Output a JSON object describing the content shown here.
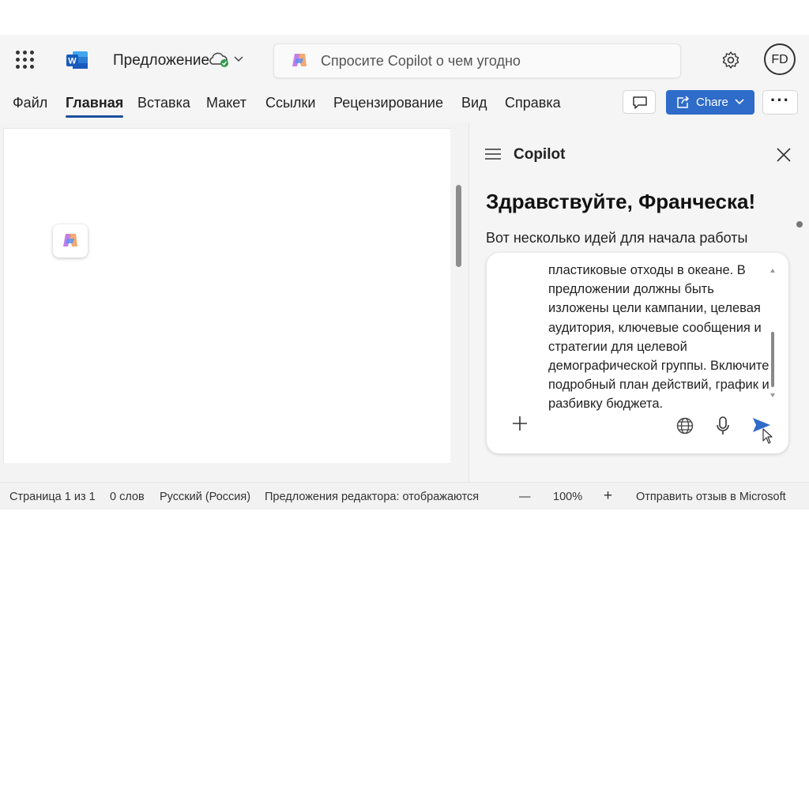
{
  "app": {
    "document_title": "Предложение",
    "search_placeholder": "Спросите Copilot о чем угодно",
    "avatar_initials": "FD",
    "accent_color": "#2f6bc9"
  },
  "ribbon": {
    "tabs": [
      {
        "label": "Файл"
      },
      {
        "label": "Главная",
        "active": true
      },
      {
        "label": "Вставка"
      },
      {
        "label": "Макет"
      },
      {
        "label": "Ссылки"
      },
      {
        "label": "Рецензирование"
      },
      {
        "label": "Вид"
      },
      {
        "label": "Справка"
      }
    ],
    "share_label": "Chare",
    "more_label": "···"
  },
  "copilot": {
    "title": "Copilot",
    "greeting": "Здравствуйте, Франческа!",
    "subtitle": "Вот несколько идей для начала работы",
    "prompt_text": "пластиковые отходы в океане. В предложении должны быть изложены цели кампании, целевая аудитория, ключевые сообщения и стратегии для целевой демографической группы. Включите подробный план действий, график и разбивку бюджета."
  },
  "status_bar": {
    "page": "Страница 1 из 1",
    "words": "0 слов",
    "language": "Русский (Россия)",
    "editor": "Предложения редактора: отображаются",
    "zoom_out": "—",
    "zoom": "100%",
    "zoom_in": "+",
    "feedback": "Отправить отзыв в Microsoft"
  },
  "icons": [
    "waffle-icon",
    "word-logo-icon",
    "cloud-sync-icon",
    "chevron-down-icon",
    "copilot-icon",
    "gear-icon",
    "comment-icon",
    "share-icon",
    "hamburger-icon",
    "close-icon",
    "plus-icon",
    "globe-icon",
    "microphone-icon",
    "send-icon",
    "cursor-icon"
  ]
}
